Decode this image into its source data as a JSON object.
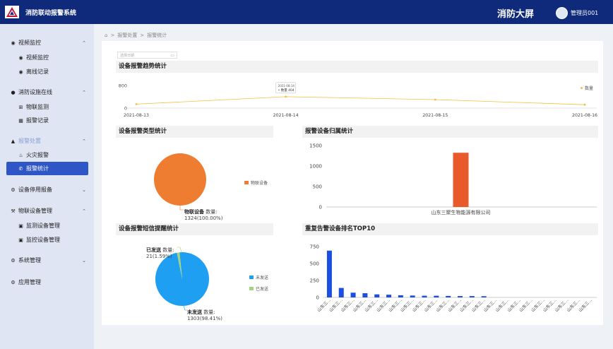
{
  "header": {
    "app_title": "消防联动报警系统",
    "big_screen": "消防大屏",
    "username": "管理员001"
  },
  "sidebar": {
    "groups": [
      {
        "label": "视频监控",
        "icon": "eye-icon",
        "expanded": true,
        "items": [
          "视频监控",
          "离线记录"
        ]
      },
      {
        "label": "消防设施在线",
        "icon": "location-icon",
        "expanded": true,
        "items": [
          "物联监测",
          "报警记录"
        ]
      },
      {
        "label": "报警处置",
        "icon": "warning-icon",
        "expanded": true,
        "items": [
          "火灾报警",
          "报警统计"
        ]
      },
      {
        "label": "设备停用报备",
        "icon": "gear-icon",
        "expanded": false,
        "items": []
      },
      {
        "label": "物联设备管理",
        "icon": "tools-icon",
        "expanded": true,
        "items": [
          "监测设备管理",
          "监控设备管理"
        ]
      },
      {
        "label": "系统管理",
        "icon": "gear-icon",
        "expanded": false,
        "items": []
      },
      {
        "label": "应用管理",
        "icon": "gear-icon",
        "expanded": false,
        "items": []
      }
    ],
    "active_item": "报警统计"
  },
  "breadcrumb": [
    "报警处置",
    "报警统计"
  ],
  "date_input": {
    "placeholder": "选择日期"
  },
  "sections": {
    "trend": "设备报警趋势统计",
    "type": "设备报警类型统计",
    "belong": "报警设备归属统计",
    "sms": "设备报警短信提醒统计",
    "top10": "重复告警设备排名TOP10"
  },
  "colors": {
    "header": "#0f2a7a",
    "accent": "#2f56c7",
    "line": "#f0c040",
    "orange": "#ee7d31",
    "red_bar": "#e85a2b",
    "blue_pie": "#1e9ff2",
    "green_pie": "#a4d47a",
    "blue_bar": "#1a4fe0"
  },
  "chart_data": [
    {
      "type": "line",
      "title": "设备报警趋势统计",
      "x": [
        "2021-08-13",
        "2021-08-14",
        "2021-08-15",
        "2021-08-16"
      ],
      "series": [
        {
          "name": "数量",
          "values": [
            140,
            404,
            300,
            120
          ]
        }
      ],
      "ylim": [
        0,
        1000
      ],
      "yticks": [
        "0",
        "800"
      ],
      "tooltip": {
        "date": "2021-08-14",
        "label": "数量",
        "value": "404"
      },
      "legend": "top-right"
    },
    {
      "type": "pie",
      "title": "设备报警类型统计",
      "slices": [
        {
          "name": "物联设备",
          "value": 1324,
          "percent": "100.00%"
        }
      ],
      "label_text": {
        "name": "物联设备",
        "mid": " 数量:",
        "value": "1324(100.00%)"
      },
      "legend": "right"
    },
    {
      "type": "bar",
      "title": "报警设备归属统计",
      "categories": [
        "山东三聚生物能源有限公司"
      ],
      "values": [
        1324
      ],
      "ylim": [
        0,
        1500
      ],
      "yticks": [
        "0",
        "500",
        "1000",
        "1500"
      ]
    },
    {
      "type": "pie",
      "title": "设备报警短信提醒统计",
      "slices": [
        {
          "name": "未发送",
          "value": 1303,
          "percent": "98.41%"
        },
        {
          "name": "已发送",
          "value": 21,
          "percent": "1.59%"
        }
      ],
      "labels": [
        {
          "name": "已发送",
          "mid": " 数量:",
          "value": "21(1.59%)"
        },
        {
          "name": "未发送",
          "mid": " 数量:",
          "value": "1303(98.41%)"
        }
      ],
      "legend": "right"
    },
    {
      "type": "bar",
      "title": "重复告警设备排名TOP10",
      "categories": [
        "山东三...",
        "山东三...",
        "山东三...",
        "山东三...",
        "山东三...",
        "山东三...",
        "山东三...",
        "山东三...",
        "山东三...",
        "山东三...",
        "山东三...",
        "山东三...",
        "山东三...",
        "山东三...",
        "山东三...",
        "山东三...",
        "山东三...",
        "山东三...",
        "山东三...",
        "山东三...",
        "山东三...",
        "山东三...",
        "山东三..."
      ],
      "values": [
        690,
        140,
        70,
        62,
        45,
        40,
        32,
        28,
        25,
        25,
        22,
        20,
        20,
        18,
        0,
        0,
        0,
        0,
        0,
        0,
        0,
        0,
        0
      ],
      "ylim": [
        0,
        750
      ],
      "yticks": [
        "0",
        "250",
        "500",
        "750"
      ]
    }
  ]
}
